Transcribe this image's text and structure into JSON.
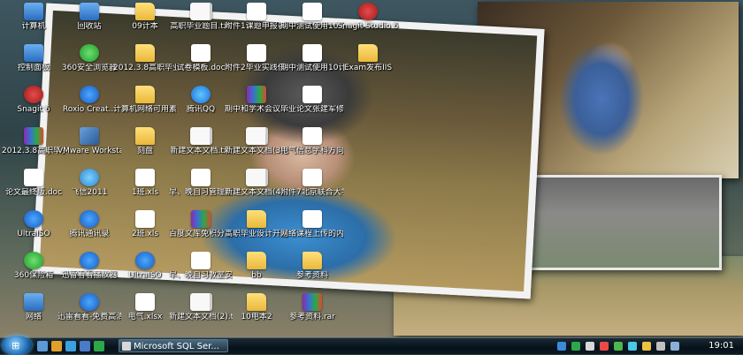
{
  "desktop_icons": [
    {
      "label": "计算机",
      "glyph": "sys",
      "icon": "computer-icon",
      "name": "desktop-icon-computer"
    },
    {
      "label": "控制面板",
      "glyph": "sys",
      "icon": "control-panel-icon",
      "name": "desktop-icon-control-panel"
    },
    {
      "label": "Snagit 6",
      "glyph": "snag",
      "icon": "snagit-icon",
      "name": "desktop-icon-snagit6"
    },
    {
      "label": "2012.3.8高职毕业设实训.rar",
      "glyph": "rar",
      "icon": "rar-archive-icon",
      "name": "desktop-icon-rar-2012"
    },
    {
      "label": "论文最终版.doc",
      "glyph": "doc",
      "icon": "word-document-icon",
      "name": "desktop-icon-thesis-final"
    },
    {
      "label": "UltraISO",
      "glyph": "app",
      "icon": "ultraiso-icon",
      "name": "desktop-icon-ultraiso"
    },
    {
      "label": "360保险箱",
      "glyph": "green",
      "icon": "safe-box-icon",
      "name": "desktop-icon-360-safe"
    },
    {
      "label": "网络",
      "glyph": "sys",
      "icon": "network-icon",
      "name": "desktop-icon-network"
    },
    {
      "label": "回收站",
      "glyph": "sys",
      "icon": "recycle-bin-icon",
      "name": "desktop-icon-recycle-bin"
    },
    {
      "label": "360安全浏览器",
      "glyph": "green",
      "icon": "browser-icon",
      "name": "desktop-icon-360-browser"
    },
    {
      "label": "Roxio Creat...",
      "glyph": "app",
      "icon": "roxio-icon",
      "name": "desktop-icon-roxio"
    },
    {
      "label": "VMware Workstation",
      "glyph": "vm",
      "icon": "vmware-icon",
      "name": "desktop-icon-vmware"
    },
    {
      "label": "飞信2011",
      "glyph": "fly",
      "icon": "fetion-icon",
      "name": "desktop-icon-fetion"
    },
    {
      "label": "腾讯通讯录",
      "glyph": "app",
      "icon": "contacts-icon",
      "name": "desktop-icon-tencent-contacts"
    },
    {
      "label": "迅雷看看播放器",
      "glyph": "app",
      "icon": "media-player-icon",
      "name": "desktop-icon-xunlei-player"
    },
    {
      "label": "迅雷看看-免费高清电影",
      "glyph": "app",
      "icon": "movie-icon",
      "name": "desktop-icon-xunlei-movies"
    },
    {
      "label": "09计本",
      "glyph": "folder",
      "icon": "folder-icon",
      "name": "desktop-icon-09jiben"
    },
    {
      "label": "2012.3.8高职毕业实践",
      "glyph": "folder",
      "icon": "folder-icon",
      "name": "desktop-icon-practice-folder"
    },
    {
      "label": "计算机网络可用素材",
      "glyph": "folder",
      "icon": "folder-icon",
      "name": "desktop-icon-network-material"
    },
    {
      "label": "刻盘",
      "glyph": "folder",
      "icon": "folder-icon",
      "name": "desktop-icon-burn-folder"
    },
    {
      "label": "1班.xls",
      "glyph": "xls",
      "icon": "excel-document-icon",
      "name": "desktop-icon-class1-xls"
    },
    {
      "label": "2班.xls",
      "glyph": "xls",
      "icon": "excel-document-icon",
      "name": "desktop-icon-class2-xls"
    },
    {
      "label": "UltraISO",
      "glyph": "app",
      "icon": "ultraiso-icon",
      "name": "desktop-icon-ultraiso-2"
    },
    {
      "label": "电气.xlsx",
      "glyph": "xls",
      "icon": "excel-document-icon",
      "name": "desktop-icon-dianqi-xlsx"
    },
    {
      "label": "高职毕业题目.txt",
      "glyph": "txt",
      "icon": "text-document-icon",
      "name": "desktop-icon-topics-txt"
    },
    {
      "label": "试卷模板.doc",
      "glyph": "doc",
      "icon": "word-document-icon",
      "name": "desktop-icon-exam-template"
    },
    {
      "label": "腾讯QQ",
      "glyph": "ie",
      "icon": "qq-icon",
      "name": "desktop-icon-qq"
    },
    {
      "label": "新建文本文档.txt",
      "glyph": "txt",
      "icon": "text-document-icon",
      "name": "desktop-icon-new-txt"
    },
    {
      "label": "早、晚自习管理规范.docx",
      "glyph": "doc",
      "icon": "word-document-icon",
      "name": "desktop-icon-study-rules"
    },
    {
      "label": "百度文库免积分下载.zip",
      "glyph": "rar",
      "icon": "zip-archive-icon",
      "name": "desktop-icon-baidu-zip"
    },
    {
      "label": "早、晚自习教室安排.doc",
      "glyph": "doc",
      "icon": "word-document-icon",
      "name": "desktop-icon-classroom-doc"
    },
    {
      "label": "新建文本文档(2).txt",
      "glyph": "txt",
      "icon": "text-document-icon",
      "name": "desktop-icon-new-txt-2"
    },
    {
      "label": "附件1课题申报表.doc",
      "glyph": "doc",
      "icon": "word-document-icon",
      "name": "desktop-icon-attach1"
    },
    {
      "label": "附件2毕业实践任务书.doc",
      "glyph": "doc",
      "icon": "word-document-icon",
      "name": "desktop-icon-attach2"
    },
    {
      "label": "期中和学术会议.rar",
      "glyph": "rar",
      "icon": "rar-archive-icon",
      "name": "desktop-icon-midterm-rar"
    },
    {
      "label": "新建文本文档(3).txt",
      "glyph": "txt",
      "icon": "text-document-icon",
      "name": "desktop-icon-new-txt-3"
    },
    {
      "label": "新建文本文档(4).txt",
      "glyph": "txt",
      "icon": "text-document-icon",
      "name": "desktop-icon-new-txt-4"
    },
    {
      "label": "高职毕业设计开题和任务书",
      "glyph": "folder",
      "icon": "folder-icon",
      "name": "desktop-icon-opening-folder"
    },
    {
      "label": "bb",
      "glyph": "folder",
      "icon": "folder-icon",
      "name": "desktop-icon-bb"
    },
    {
      "label": "10电本2",
      "glyph": "folder",
      "icon": "folder-icon",
      "name": "desktop-icon-10dianben2"
    },
    {
      "label": "期中测试使用10电本.doc",
      "glyph": "doc",
      "icon": "word-document-icon",
      "name": "desktop-icon-midterm-doc1"
    },
    {
      "label": "期中测试使用10计本.doc",
      "glyph": "doc",
      "icon": "word-document-icon",
      "name": "desktop-icon-midterm-doc2"
    },
    {
      "label": "毕业论文张建军修改中.doc",
      "glyph": "doc",
      "icon": "word-document-icon",
      "name": "desktop-icon-thesis-editing"
    },
    {
      "label": "电气信息学科方向简表...",
      "glyph": "doc",
      "icon": "word-document-icon",
      "name": "desktop-icon-discipline-doc"
    },
    {
      "label": "附件7北京联合大学师范...",
      "glyph": "doc",
      "icon": "word-document-icon",
      "name": "desktop-icon-attach7"
    },
    {
      "label": "网络课程上传的内容清单...",
      "glyph": "doc",
      "icon": "word-document-icon",
      "name": "desktop-icon-course-list"
    },
    {
      "label": "参考资料",
      "glyph": "folder",
      "icon": "folder-icon",
      "name": "desktop-icon-references-folder"
    },
    {
      "label": "参考资料.rar",
      "glyph": "rar",
      "icon": "rar-archive-icon",
      "name": "desktop-icon-references-rar"
    },
    {
      "label": "Snagit Studio 6",
      "glyph": "snag",
      "icon": "snagit-studio-icon",
      "name": "desktop-icon-snagit-studio"
    },
    {
      "label": "Exam发布IIS",
      "glyph": "folder",
      "icon": "folder-icon",
      "name": "desktop-icon-exam-iis"
    }
  ],
  "taskbar": {
    "active_window": "Microsoft SQL Ser...",
    "clock": "19:01"
  }
}
